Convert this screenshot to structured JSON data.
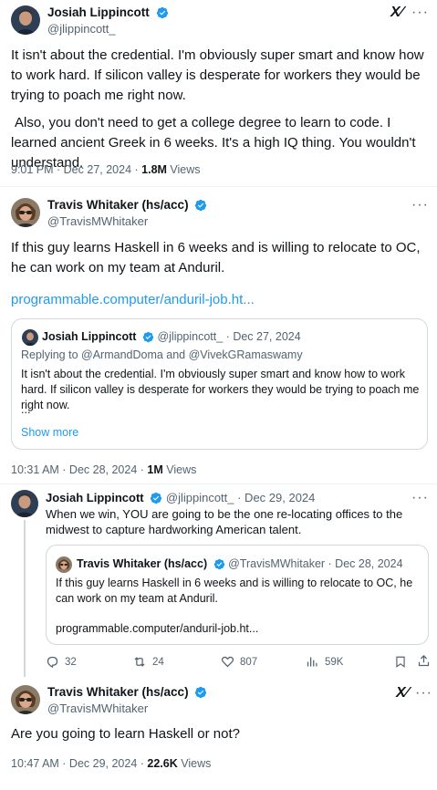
{
  "tweet1": {
    "name": "Josiah Lippincott",
    "handle": "@jlippincott_",
    "brand_label": "X⁄",
    "text1": "It isn't about the credential. I'm obviously super smart and know how to work hard. If silicon valley is desperate for workers they would be trying to poach me right now.",
    "text2": "Also, you don't need to get a college degree to learn to code. I learned ancient Greek in 6 weeks. It's a high IQ thing. You wouldn't understand.",
    "time": "9:01 PM · Dec 27, 2024 · ",
    "views_count": "1.8M",
    "views_label": " Views"
  },
  "tweet2": {
    "name": "Travis Whitaker (hs/acc)",
    "handle": "@TravisMWhitaker",
    "text": "If this guy learns Haskell in 6 weeks and is willing to relocate to OC, he can work on my team at Anduril.",
    "link": "programmable.computer/anduril-job.ht...",
    "quote": {
      "name": "Josiah Lippincott",
      "meta": "@jlippincott_ · Dec 27, 2024",
      "replying": "Replying to @ArmandDoma and @VivekGRamaswamy",
      "text": "It isn't about the credential. I'm obviously super smart and know how to work hard. If silicon valley is desperate for workers they would be trying to poach me right now.",
      "ellipsis": "...",
      "show_more": "Show more"
    },
    "time": "10:31 AM · Dec 28, 2024 · ",
    "views_count": "1M",
    "views_label": " Views"
  },
  "tweet3": {
    "name": "Josiah Lippincott",
    "meta": "@jlippincott_ · Dec 29, 2024",
    "text": "When we win, YOU are going to be the one re-locating offices to the midwest to capture hardworking American talent.",
    "quote": {
      "name": "Travis Whitaker (hs/acc)",
      "meta": "@TravisMWhitaker · Dec 28, 2024",
      "text": "If this guy learns Haskell in 6 weeks and is willing to relocate to OC, he can work on my team at Anduril.",
      "link": "programmable.computer/anduril-job.ht..."
    },
    "actions": {
      "replies": "32",
      "retweets": "24",
      "likes": "807",
      "views": "59K"
    }
  },
  "tweet4": {
    "name": "Travis Whitaker (hs/acc)",
    "handle": "@TravisMWhitaker",
    "brand_label": "X⁄",
    "text": "Are you going to learn Haskell or not?",
    "time": "10:47 AM · Dec 29, 2024 · ",
    "views_count": "22.6K",
    "views_label": " Views"
  },
  "colors": {
    "verified": "#1d9bf0",
    "link": "#1d9bf0",
    "secondary": "#536471"
  }
}
